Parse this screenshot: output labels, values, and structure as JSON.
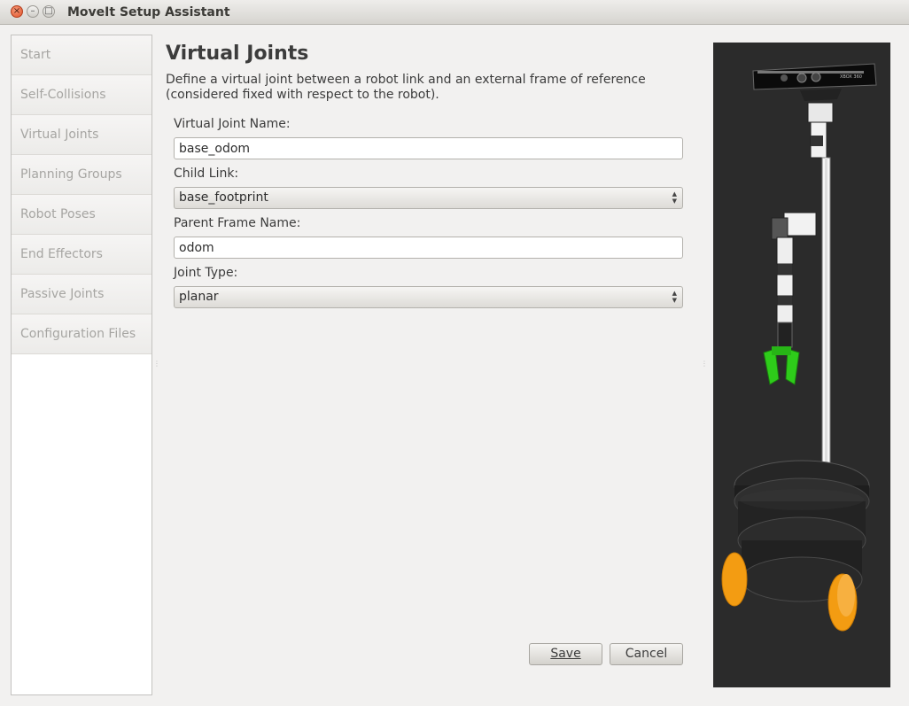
{
  "window": {
    "title": "MoveIt Setup Assistant"
  },
  "nav": {
    "items": [
      {
        "label": "Start"
      },
      {
        "label": "Self-Collisions"
      },
      {
        "label": "Virtual Joints"
      },
      {
        "label": "Planning Groups"
      },
      {
        "label": "Robot Poses"
      },
      {
        "label": "End Effectors"
      },
      {
        "label": "Passive Joints"
      },
      {
        "label": "Configuration Files"
      }
    ]
  },
  "page": {
    "title": "Virtual Joints",
    "description": "Define a virtual joint between a robot link and an external frame of reference (considered fixed with respect to the robot)."
  },
  "form": {
    "joint_name_label": "Virtual Joint Name:",
    "joint_name_value": "base_odom",
    "child_link_label": "Child Link:",
    "child_link_value": "base_footprint",
    "parent_frame_label": "Parent Frame Name:",
    "parent_frame_value": "odom",
    "joint_type_label": "Joint Type:",
    "joint_type_value": "planar"
  },
  "buttons": {
    "save": "Save",
    "cancel": "Cancel"
  },
  "viewer": {
    "sensor_text": "XBOX 360"
  },
  "colors": {
    "viewer_bg": "#2b2b2b",
    "gripper": "#2ecc1a",
    "wheels": "#f39c12"
  }
}
